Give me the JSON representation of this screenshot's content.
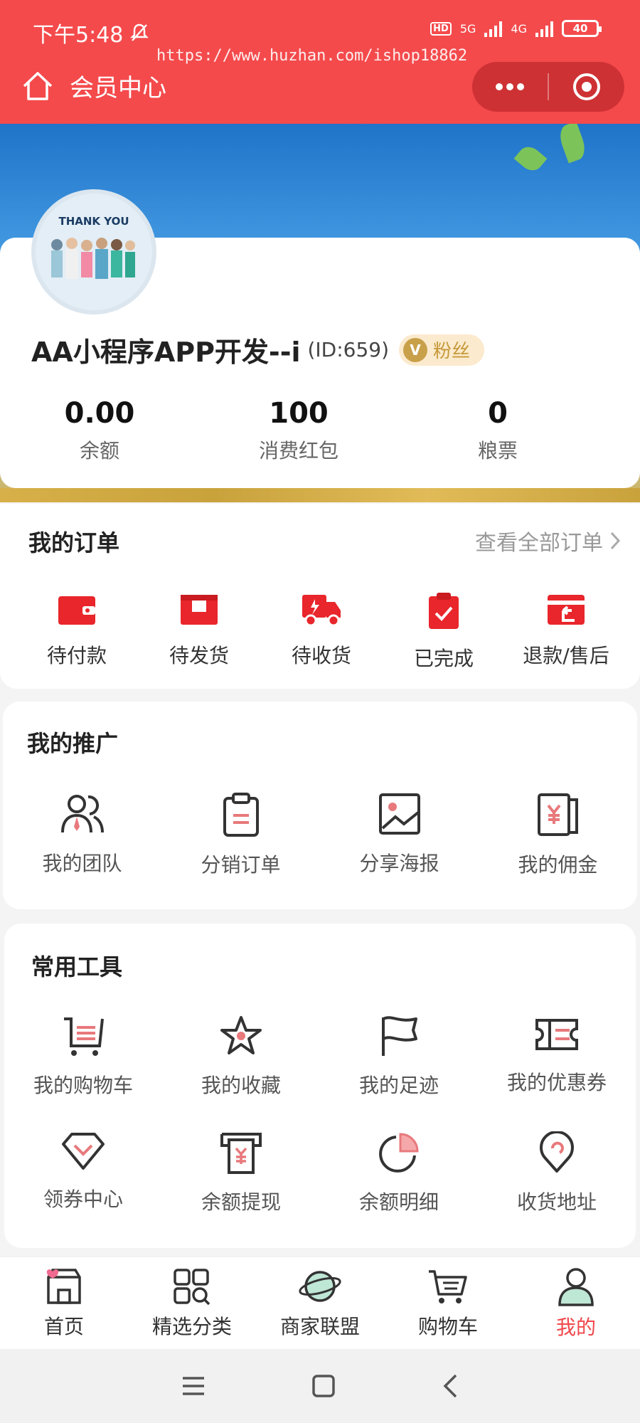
{
  "status_bar": {
    "time": "下午5:48",
    "network_left": "5G",
    "network_right": "4G",
    "battery": "40",
    "hd": "HD"
  },
  "watermark": "https://www.huzhan.com/ishop18862",
  "header": {
    "title": "会员中心"
  },
  "profile": {
    "avatar_text": "THANK YOU",
    "name": "AA小程序APP开发--i",
    "id_text": "(ID:659)",
    "badge": "粉丝",
    "stats": [
      {
        "value": "0.00",
        "label": "余额"
      },
      {
        "value": "100",
        "label": "消费红包"
      },
      {
        "value": "0",
        "label": "粮票"
      }
    ]
  },
  "orders": {
    "title": "我的订单",
    "view_all": "查看全部订单",
    "items": [
      {
        "label": "待付款",
        "icon": "wallet-icon"
      },
      {
        "label": "待发货",
        "icon": "box-icon"
      },
      {
        "label": "待收货",
        "icon": "truck-icon"
      },
      {
        "label": "已完成",
        "icon": "clipboard-check-icon"
      },
      {
        "label": "退款/售后",
        "icon": "refund-icon"
      }
    ]
  },
  "promotion": {
    "title": "我的推广",
    "items": [
      {
        "label": "我的团队",
        "icon": "team-icon"
      },
      {
        "label": "分销订单",
        "icon": "clipboard-icon"
      },
      {
        "label": "分享海报",
        "icon": "poster-icon"
      },
      {
        "label": "我的佣金",
        "icon": "commission-icon"
      }
    ]
  },
  "tools": {
    "title": "常用工具",
    "items": [
      {
        "label": "我的购物车",
        "icon": "cart-icon"
      },
      {
        "label": "我的收藏",
        "icon": "star-icon"
      },
      {
        "label": "我的足迹",
        "icon": "flag-icon"
      },
      {
        "label": "我的优惠券",
        "icon": "coupon-icon"
      },
      {
        "label": "领券中心",
        "icon": "diamond-icon"
      },
      {
        "label": "余额提现",
        "icon": "withdraw-icon"
      },
      {
        "label": "余额明细",
        "icon": "pie-icon"
      },
      {
        "label": "收货地址",
        "icon": "location-icon"
      }
    ]
  },
  "tabbar": [
    {
      "label": "首页",
      "icon": "home-icon"
    },
    {
      "label": "精选分类",
      "icon": "category-icon"
    },
    {
      "label": "商家联盟",
      "icon": "planet-icon"
    },
    {
      "label": "购物车",
      "icon": "cart-icon"
    },
    {
      "label": "我的",
      "icon": "user-icon"
    }
  ],
  "colors": {
    "brand": "#f44a4c",
    "accent_red": "#e8262b",
    "badge_gold": "#c9a04a",
    "active_tab": "#f0474b"
  }
}
